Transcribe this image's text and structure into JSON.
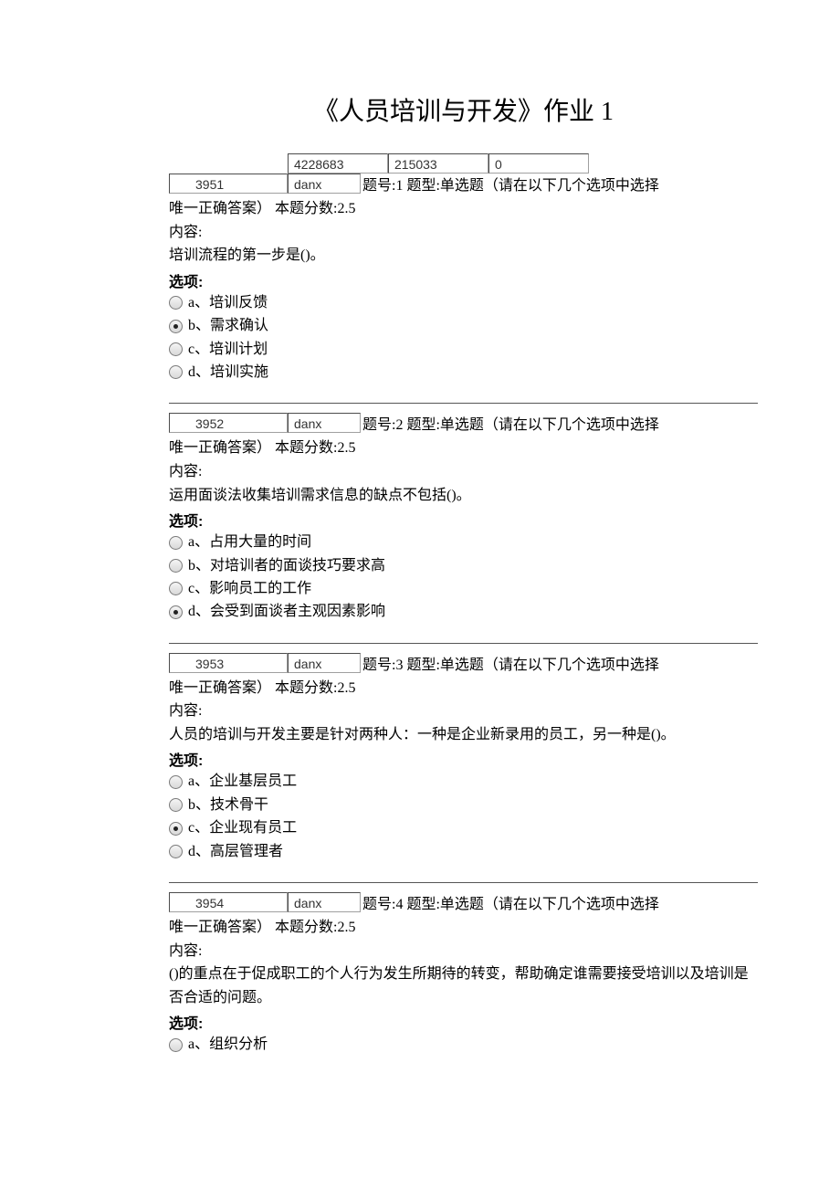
{
  "page_title": "《人员培训与开发》作业 1",
  "header_fields": {
    "v1": "4228683",
    "v2": "215033",
    "v3": "0"
  },
  "questions": [
    {
      "qid": "3951",
      "type_code": "danx",
      "header_line": "题号:1 题型:单选题（请在以下几个选项中选择",
      "header_cont": "唯一正确答案）  本题分数:2.5",
      "content_label": "内容:",
      "content": "培训流程的第一步是()。",
      "options_label": "选项:",
      "options": [
        {
          "letter": "a",
          "text": "培训反馈",
          "checked": false
        },
        {
          "letter": "b",
          "text": "需求确认",
          "checked": true
        },
        {
          "letter": "c",
          "text": "培训计划",
          "checked": false
        },
        {
          "letter": "d",
          "text": "培训实施",
          "checked": false
        }
      ]
    },
    {
      "qid": "3952",
      "type_code": "danx",
      "header_line": "题号:2 题型:单选题（请在以下几个选项中选择",
      "header_cont": "唯一正确答案）  本题分数:2.5",
      "content_label": "内容:",
      "content": "运用面谈法收集培训需求信息的缺点不包括()。",
      "options_label": "选项:",
      "options": [
        {
          "letter": "a",
          "text": "占用大量的时间",
          "checked": false
        },
        {
          "letter": "b",
          "text": "对培训者的面谈技巧要求高",
          "checked": false
        },
        {
          "letter": "c",
          "text": "影响员工的工作",
          "checked": false
        },
        {
          "letter": "d",
          "text": "会受到面谈者主观因素影响",
          "checked": true
        }
      ]
    },
    {
      "qid": "3953",
      "type_code": "danx",
      "header_line": "题号:3 题型:单选题（请在以下几个选项中选择",
      "header_cont": "唯一正确答案）  本题分数:2.5",
      "content_label": "内容:",
      "content": "人员的培训与开发主要是针对两种人：一种是企业新录用的员工，另一种是()。",
      "options_label": "选项:",
      "options": [
        {
          "letter": "a",
          "text": "企业基层员工",
          "checked": false
        },
        {
          "letter": "b",
          "text": "技术骨干",
          "checked": false
        },
        {
          "letter": "c",
          "text": "企业现有员工",
          "checked": true
        },
        {
          "letter": "d",
          "text": "高层管理者",
          "checked": false
        }
      ]
    },
    {
      "qid": "3954",
      "type_code": "danx",
      "header_line": "题号:4 题型:单选题（请在以下几个选项中选择",
      "header_cont": "唯一正确答案）  本题分数:2.5",
      "content_label": "内容:",
      "content": "()的重点在于促成职工的个人行为发生所期待的转变，帮助确定谁需要接受培训以及培训是否合适的问题。",
      "options_label": "选项:",
      "options": [
        {
          "letter": "a",
          "text": "组织分析",
          "checked": false
        }
      ]
    }
  ]
}
